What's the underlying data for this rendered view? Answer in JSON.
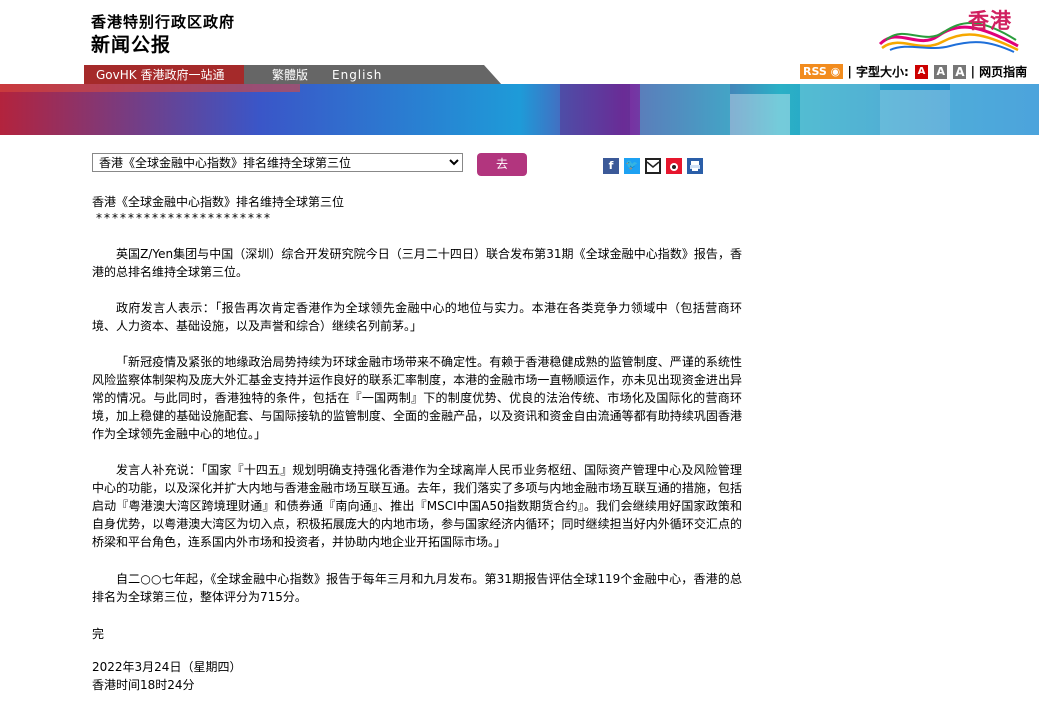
{
  "header": {
    "gov_name": "香港特别行政区政府",
    "press_release": "新闻公报",
    "logo_text": "香港"
  },
  "nav": {
    "govhk": "GovHK 香港政府一站通",
    "trad": "繁體版",
    "english": "English"
  },
  "tools": {
    "rss": "RSS",
    "font_size": "字型大小:",
    "sizes": [
      "A",
      "A",
      "A"
    ],
    "guide": "网页指南"
  },
  "selector": {
    "value": "香港《全球金融中心指数》排名维持全球第三位",
    "go": "去"
  },
  "share_icons": [
    "facebook-icon",
    "twitter-icon",
    "email-icon",
    "weibo-icon",
    "print-icon"
  ],
  "article": {
    "title": "香港《全球金融中心指数》排名维持全球第三位",
    "stars": "**********************",
    "paragraphs": [
      "英国Z/Yen集团与中国（深圳）综合开发研究院今日（三月二十四日）联合发布第31期《全球金融中心指数》报告，香港的总排名维持全球第三位。",
      "政府发言人表示：「报告再次肯定香港作为全球领先金融中心的地位与实力。本港在各类竞争力领域中（包括营商环境、人力资本、基础设施，以及声誉和综合）继续名列前茅。」",
      "「新冠疫情及紧张的地缘政治局势持续为环球金融市场带来不确定性。有赖于香港稳健成熟的监管制度、严谨的系统性风险监察体制架构及庞大外汇基金支持并运作良好的联系汇率制度，本港的金融市场一直畅顺运作，亦未见出现资金进出异常的情况。与此同时，香港独特的条件，包括在『一国两制』下的制度优势、优良的法治传统、市场化及国际化的营商环境，加上稳健的基础设施配套、与国际接轨的监管制度、全面的金融产品，以及资讯和资金自由流通等都有助持续巩固香港作为全球领先金融中心的地位。」",
      "发言人补充说：「国家『十四五』规划明确支持强化香港作为全球离岸人民币业务枢纽、国际资产管理中心及风险管理中心的功能，以及深化并扩大内地与香港金融市场互联互通。去年，我们落实了多项与内地金融市场互联互通的措施，包括启动『粤港澳大湾区跨境理财通』和债券通『南向通』、推出『MSCI中国A50指数期货合约』。我们会继续用好国家政策和自身优势，以粤港澳大湾区为切入点，积极拓展庞大的内地市场，参与国家经济内循环；同时继续担当好内外循环交汇点的桥梁和平台角色，连系国内外市场和投资者，并协助内地企业开拓国际市场。」",
      "自二○○七年起，《全球金融中心指数》报告于每年三月和九月发布。第31期报告评估全球119个金融中心，香港的总排名为全球第三位，整体评分为715分。"
    ],
    "end": "完",
    "date": "2022年3月24日（星期四）",
    "time": "香港时间18时24分"
  }
}
